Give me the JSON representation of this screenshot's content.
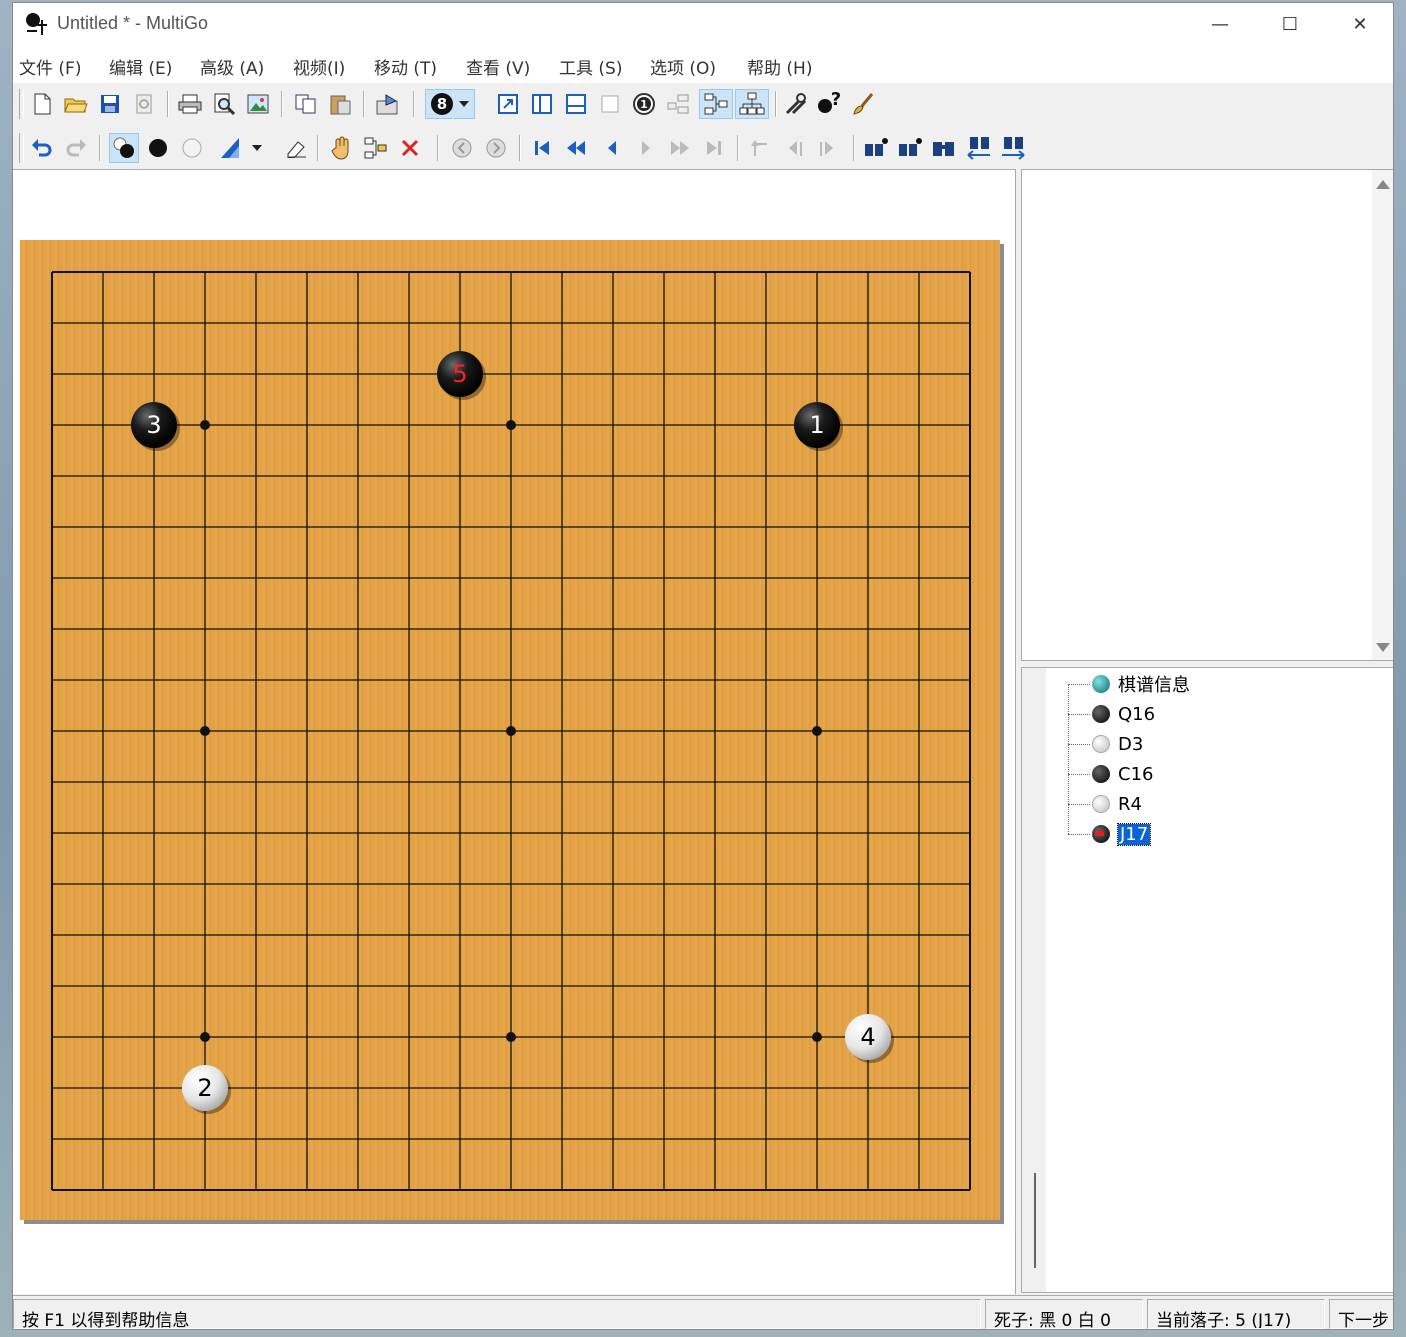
{
  "window": {
    "title": "Untitled  * - MultiGo",
    "controls": {
      "minimize": "—",
      "maximize": "☐",
      "close": "✕"
    }
  },
  "menu": [
    "文件 (F)",
    "编辑 (E)",
    "高级 (A)",
    "视频(I)",
    "移动 (T)",
    "查看 (V)",
    "工具 (S)",
    "选项 (O)",
    "帮助 (H)"
  ],
  "toolbar": {
    "number_badge": "8",
    "move_number_badge": "1"
  },
  "board": {
    "size": 19,
    "stones": [
      {
        "move": "1",
        "color": "black",
        "col": 15,
        "row": 3,
        "label_color": "#ffffff"
      },
      {
        "move": "2",
        "color": "white",
        "col": 3,
        "row": 16,
        "label_color": "#000000"
      },
      {
        "move": "3",
        "color": "black",
        "col": 2,
        "row": 3,
        "label_color": "#ffffff"
      },
      {
        "move": "4",
        "color": "white",
        "col": 16,
        "row": 15,
        "label_color": "#000000"
      },
      {
        "move": "5",
        "color": "black",
        "col": 8,
        "row": 2,
        "label_color": "#ff2020"
      }
    ],
    "star_points": [
      [
        3,
        3
      ],
      [
        9,
        3
      ],
      [
        15,
        3
      ],
      [
        3,
        9
      ],
      [
        9,
        9
      ],
      [
        15,
        9
      ],
      [
        3,
        15
      ],
      [
        9,
        15
      ],
      [
        15,
        15
      ]
    ]
  },
  "tree": {
    "items": [
      {
        "label": "棋谱信息",
        "kind": "info"
      },
      {
        "label": "Q16",
        "kind": "black"
      },
      {
        "label": "D3",
        "kind": "white"
      },
      {
        "label": "C16",
        "kind": "black"
      },
      {
        "label": "R4",
        "kind": "white"
      },
      {
        "label": "J17",
        "kind": "current"
      }
    ]
  },
  "status": {
    "help": "按 F1 以得到帮助信息",
    "captures": "死子:  黑 0 白 0",
    "current_move": "当前落子: 5 (J17)",
    "next": "下一步"
  }
}
